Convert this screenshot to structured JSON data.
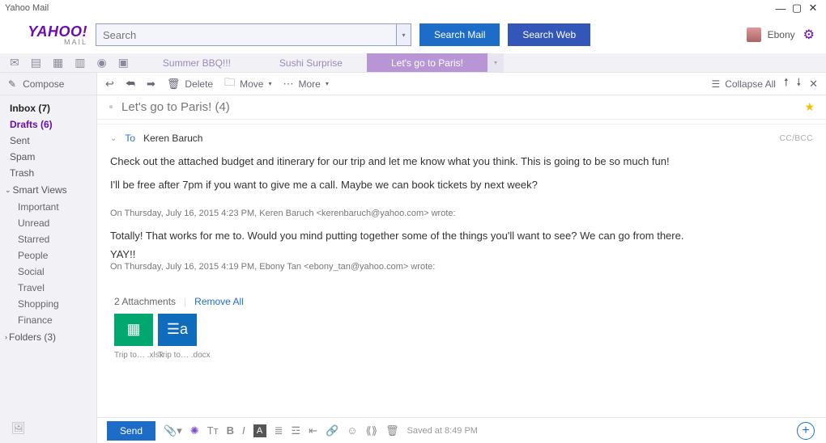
{
  "window_title": "Yahoo Mail",
  "logo": {
    "brand": "YAHOO!",
    "sub": "MAIL"
  },
  "search": {
    "placeholder": "Search",
    "btn_mail": "Search Mail",
    "btn_web": "Search Web"
  },
  "user": {
    "name": "Ebony"
  },
  "tabs": [
    {
      "label": "Summer BBQ!!!",
      "active": false
    },
    {
      "label": "Sushi Surprise",
      "active": false
    },
    {
      "label": "Let's go to Paris!",
      "active": true
    }
  ],
  "sidebar": {
    "compose": "Compose",
    "folders": [
      {
        "label": "Inbox (7)",
        "bold": true
      },
      {
        "label": "Drafts (6)",
        "selected": true
      },
      {
        "label": "Sent"
      },
      {
        "label": "Spam"
      },
      {
        "label": "Trash"
      }
    ],
    "smartviews_label": "Smart Views",
    "smartviews": [
      "Important",
      "Unread",
      "Starred",
      "People",
      "Social",
      "Travel",
      "Shopping",
      "Finance"
    ],
    "folders_section": "Folders (3)"
  },
  "actionbar": {
    "delete": "Delete",
    "move": "Move",
    "more": "More",
    "collapse": "Collapse All"
  },
  "thread": {
    "subject": "Let's go to Paris! (4)",
    "to_label": "To",
    "to_name": "Keren Baruch",
    "ccbcc": "CC/BCC",
    "body1": "Check out the attached budget and itinerary for our trip and let me know what you think. This is going to be so much fun!",
    "body2": "I'll be free after 7pm if you want to give me a call. Maybe we can book tickets by next week?",
    "quote1_meta": "On Thursday, July 16, 2015 4:23 PM, Keren Baruch <kerenbaruch@yahoo.com> wrote:",
    "quote1_body": "Totally! That works for me to. Would you mind putting together some of the things you'll want to see? We can go from there.",
    "quote1_yay": "YAY!!",
    "quote2_meta": "On Thursday, July 16, 2015 4:19 PM, Ebony Tan <ebony_tan@yahoo.com> wrote:"
  },
  "attachments": {
    "count_label": "2 Attachments",
    "remove_all": "Remove All",
    "files": [
      {
        "name": "Trip to… .xlsx",
        "type": "xlsx"
      },
      {
        "name": "Trip to… .docx",
        "type": "docx"
      }
    ]
  },
  "compose_toolbar": {
    "send": "Send",
    "saved": "Saved at 8:49 PM"
  }
}
